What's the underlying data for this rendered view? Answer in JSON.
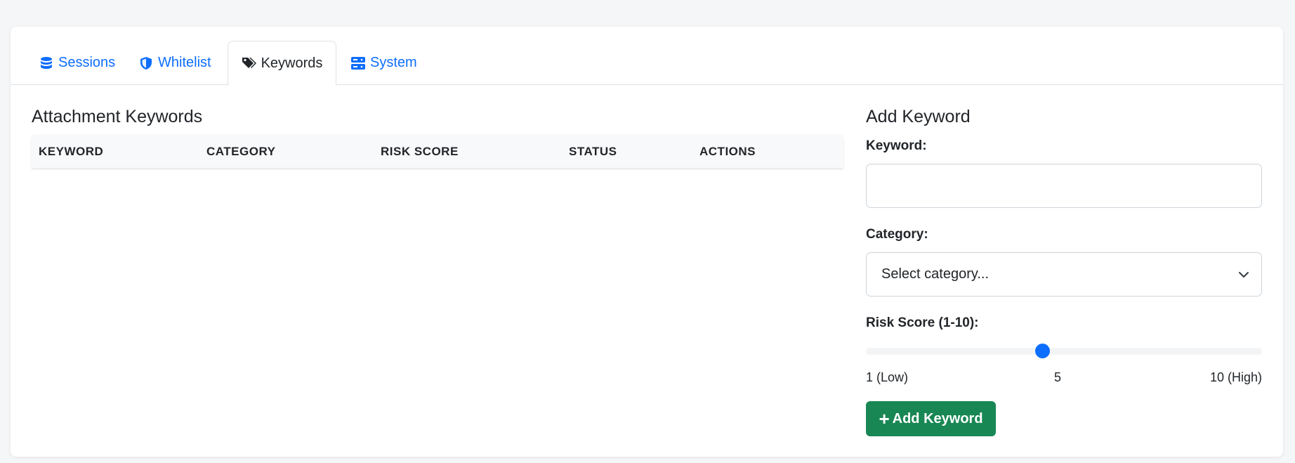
{
  "tabs": [
    {
      "label": "Sessions",
      "icon": "database-icon",
      "active": false
    },
    {
      "label": "Whitelist",
      "icon": "shield-icon",
      "active": false
    },
    {
      "label": "Keywords",
      "icon": "tags-icon",
      "active": true
    },
    {
      "label": "System",
      "icon": "server-icon",
      "active": false
    }
  ],
  "keywords_table": {
    "title": "Attachment Keywords",
    "columns": [
      "KEYWORD",
      "CATEGORY",
      "RISK SCORE",
      "STATUS",
      "ACTIONS"
    ],
    "rows": []
  },
  "add_form": {
    "title": "Add Keyword",
    "keyword_label": "Keyword:",
    "keyword_value": "",
    "category_label": "Category:",
    "category_selected": "Select category...",
    "risk_label": "Risk Score (1-10):",
    "risk_value": 5,
    "risk_min_label": "1 (Low)",
    "risk_max_label": "10 (High)",
    "risk_mid_label": "5",
    "submit_label": "Add Keyword"
  },
  "colors": {
    "accent": "#0d6efd",
    "success": "#198754"
  }
}
